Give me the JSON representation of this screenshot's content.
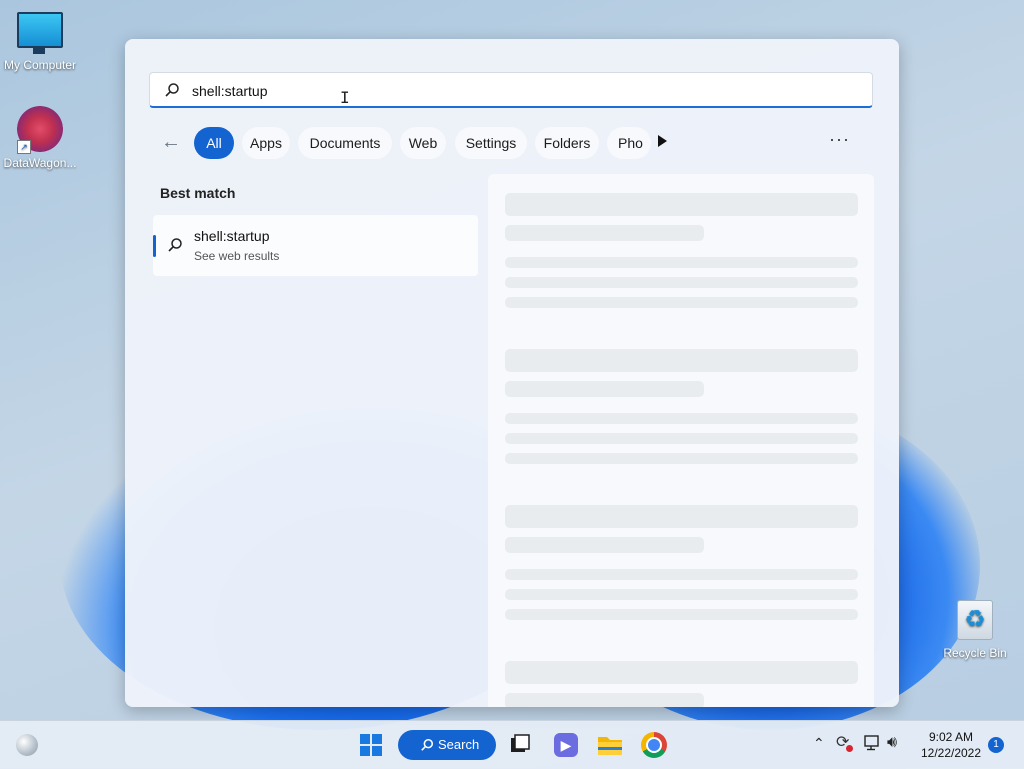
{
  "desktop": {
    "icons": [
      {
        "label": "My Computer"
      },
      {
        "label": "DataWagon..."
      },
      {
        "label": "Recycle Bin"
      }
    ]
  },
  "search": {
    "value": "shell:startup",
    "placeholder": ""
  },
  "filters": {
    "chips": [
      "All",
      "Apps",
      "Documents",
      "Web",
      "Settings",
      "Folders",
      "Pho"
    ],
    "active": "All",
    "more_label": "···"
  },
  "results": {
    "section_label": "Best match",
    "best": {
      "title": "shell:startup",
      "subtitle": "See web results"
    }
  },
  "taskbar": {
    "search_label": "Search",
    "time": "9:02 AM",
    "date": "12/22/2022",
    "notification_count": "1"
  },
  "colors": {
    "accent": "#1363d1",
    "panel_bg": "#eef3fa",
    "skeleton": "#e9ecef"
  },
  "icons": [
    "search-icon",
    "back-arrow-icon",
    "play-icon",
    "windows-logo-icon",
    "task-view-icon",
    "teams-icon",
    "folder-icon",
    "chrome-icon",
    "edge-icon",
    "chevron-up-icon",
    "sync-icon",
    "network-icon",
    "volume-icon"
  ]
}
